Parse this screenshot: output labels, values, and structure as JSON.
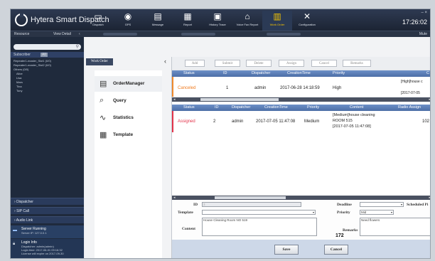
{
  "app": {
    "title": "Hytera Smart Dispatch",
    "clock": "17:26:02",
    "window_controls": "– ×",
    "nav": [
      {
        "label": "Dispatch",
        "icon": "monitor-icon"
      },
      {
        "label": "GPS",
        "icon": "gps-icon"
      },
      {
        "label": "Message",
        "icon": "message-icon"
      },
      {
        "label": "Report",
        "icon": "report-icon"
      },
      {
        "label": "History Trace",
        "icon": "history-trace-icon"
      },
      {
        "label": "Voice Fax Report",
        "icon": "voice-report-icon"
      },
      {
        "label": "Work Order",
        "icon": "work-order-icon",
        "active": true
      },
      {
        "label": "Configuration",
        "icon": "tools-icon"
      }
    ]
  },
  "subbar": {
    "left_label": "Resource",
    "view_detail": "View Detail",
    "mute": "Mute"
  },
  "sidebar": {
    "section_title": "Subscriber",
    "filter": "All",
    "tree": [
      "Repeater1-master_Slot1 (0/0)",
      "Repeater1-master_Slot2 (0/0)",
      "Others (0/0)",
      "Alice",
      "Lisa",
      "Mars",
      "Tina",
      "Tony"
    ],
    "sections": [
      "Dispatcher",
      "SIP Call",
      "Audio Link"
    ],
    "server": {
      "title": "Server Running",
      "detail": "Server IP: 127.0.0.1"
    },
    "login": {
      "title": "Login Info",
      "lines": [
        "Dispatcher: admin(admin)",
        "Login time: 2017-06-01 09:16:32",
        "License will expire on 2017-09-30"
      ]
    }
  },
  "workorder": {
    "tab": "Work Order",
    "menu": [
      {
        "label": "OrderManager",
        "icon": "order-manager-icon"
      },
      {
        "label": "Query",
        "icon": "query-icon"
      },
      {
        "label": "Statistics",
        "icon": "statistics-icon"
      },
      {
        "label": "Template",
        "icon": "template-icon"
      }
    ],
    "toolbar": [
      "Add",
      "Submit",
      "Delete",
      "Assign",
      "Cancel",
      "Remarks"
    ],
    "table1": {
      "headers": [
        "Status",
        "ID",
        "Dispatcher",
        "CreationTime",
        "Priority",
        "C"
      ],
      "rows": [
        {
          "status": "Canceled",
          "id": "1",
          "dispatcher": "admin",
          "time": "2017-06-28 14:18:59",
          "priority": "High",
          "content1": "[High]house c",
          "content2": "[2017-07-05"
        }
      ]
    },
    "table2": {
      "headers": [
        "Status",
        "ID",
        "Dispatcher",
        "CreationTime",
        "Priority",
        "Content",
        "Radio Assign"
      ],
      "rows": [
        {
          "status": "Assigned",
          "id": "2",
          "dispatcher": "admin",
          "time": "2017-07-05 11:47:08",
          "priority": "Medium",
          "content1": "[Medium]house cleaning",
          "content2": "ROOM 515",
          "content3": "[2017-07-05 11:47:08]",
          "radio": "102"
        }
      ]
    },
    "form": {
      "id_label": "ID",
      "id_value": "3",
      "template_label": "Template",
      "template_value": "",
      "content_label": "Content",
      "content_value": "House Cleaning Room NO 519",
      "deadline_label": "Deadline",
      "deadline_value": "",
      "scheduled_label": "Scheduled Pi",
      "priority_label": "Priority",
      "priority_value": "Mid",
      "remarks_label": "Remarks",
      "remarks_value": "Need flowers",
      "count": "172"
    },
    "save": "Save",
    "cancel": "Cancel"
  }
}
